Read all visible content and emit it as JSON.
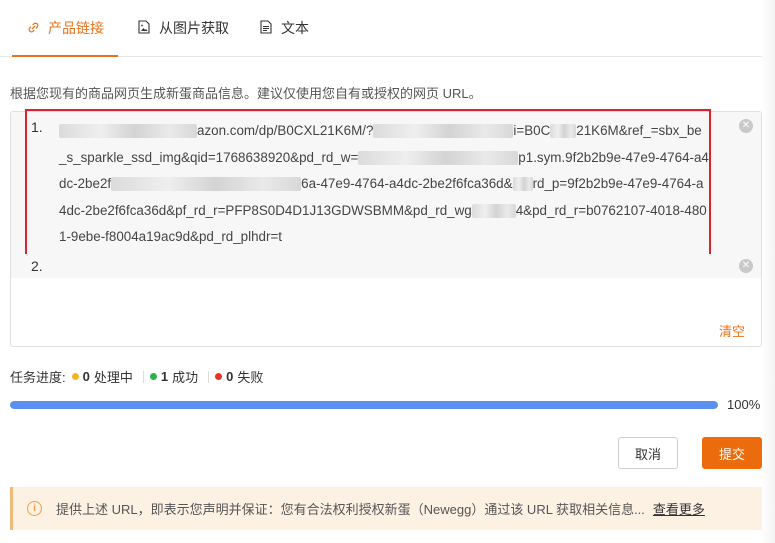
{
  "tabs": [
    {
      "label": "产品链接",
      "icon": "link-icon",
      "active": true
    },
    {
      "label": "从图片获取",
      "icon": "image-file-icon",
      "active": false
    },
    {
      "label": "文本",
      "icon": "text-file-icon",
      "active": false
    }
  ],
  "description": "根据您现有的商品网页生成新蛋商品信息。建议仅使用您自有或授权的网页 URL。",
  "url_list": {
    "items": [
      {
        "index": "1.",
        "seg1": "azon.com/dp/B0CXL21K6M/?",
        "seg2": "i=B0C",
        "seg3": "21K6M&ref_=sbx_be_s_sparkle_ssd_img&qid=176863892",
        "seg4": "0&pd_rd_w=",
        "seg5": "p1.sym.9f2b2b9e-47e9-4764-a4dc-2be2f",
        "seg6": "6a-47e9-4764-a4dc-2be2f6fca36d&",
        "seg7": "rd_p=9f2b2b9e-47e9-4764-a4dc-2be2f6fca36d&pf_rd_r=PFP8S0D4D1J13GDWSBMM&pd_rd_wg",
        "seg8": "4&pd_rd_r=b0762107-4018-4801-9ebe-f8004a19ac9d&pd_rd_plhdr=t"
      },
      {
        "index": "2.",
        "value": ""
      }
    ],
    "clear_label": "清空",
    "highlight_color": "#d9242f"
  },
  "progress": {
    "label": "任务进度:",
    "processing": {
      "count": "0",
      "label": "处理中",
      "color": "#f5b51c"
    },
    "success": {
      "count": "1",
      "label": "成功",
      "color": "#2db34a"
    },
    "failed": {
      "count": "0",
      "label": "失败",
      "color": "#e8352b"
    },
    "percent_text": "100%",
    "fraction": 1.0
  },
  "buttons": {
    "cancel": "取消",
    "submit": "提交"
  },
  "notice": {
    "text": "提供上述 URL，即表示您声明并保证：您有合法权利授权新蛋（Newegg）通过该 URL 获取相关信息...",
    "more": "查看更多"
  },
  "colors": {
    "accent": "#ec6b0c",
    "progress_bar": "#5b8ff0"
  }
}
